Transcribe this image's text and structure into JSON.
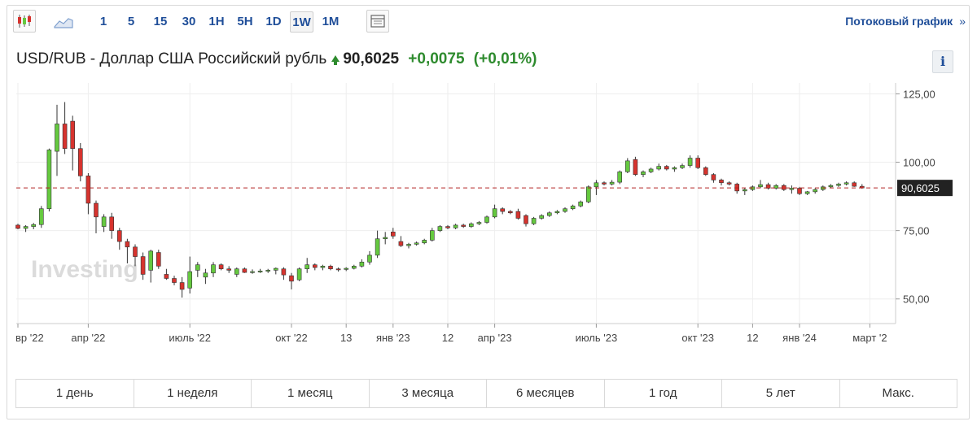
{
  "toolbar": {
    "icons": [
      "candlestick-chart-icon",
      "area-chart-icon",
      "table-view-icon"
    ],
    "intervals": [
      "1",
      "5",
      "15",
      "30",
      "1H",
      "5H",
      "1D",
      "1W",
      "1M"
    ],
    "active_interval": "1W",
    "stream_link": "Потоковый график",
    "stream_chevron": "»"
  },
  "header": {
    "pair": "USD/RUB - Доллар США Российский рубль",
    "price": "90,6025",
    "change": "+0,0075",
    "change_pct": "(+0,01%)",
    "info": "i"
  },
  "watermark": "Investing",
  "price_tag": "90,6025",
  "range_buttons": [
    "1 день",
    "1 неделя",
    "1 месяц",
    "3 месяца",
    "6 месяцев",
    "1 год",
    "5 лет",
    "Макс."
  ],
  "colors": {
    "up": "#65c93f",
    "down": "#d6332e",
    "link": "#1f4e99",
    "change": "#2e8b2e",
    "price_line": "#b22222"
  },
  "chart_data": {
    "type": "candlestick",
    "interval": "1W",
    "y_ticks": [
      "125,00",
      "100,00",
      "75,00",
      "50,00"
    ],
    "y_tick_values": [
      125,
      100,
      75,
      50
    ],
    "ylim": [
      41,
      129
    ],
    "x_ticks": [
      {
        "label": "вр '22",
        "i": 0
      },
      {
        "label": "апр '22",
        "i": 9
      },
      {
        "label": "июль '22",
        "i": 22
      },
      {
        "label": "окт '22",
        "i": 35
      },
      {
        "label": "13",
        "i": 42
      },
      {
        "label": "янв '23",
        "i": 48
      },
      {
        "label": "12",
        "i": 55
      },
      {
        "label": "апр '23",
        "i": 61
      },
      {
        "label": "июль '23",
        "i": 74
      },
      {
        "label": "окт '23",
        "i": 87
      },
      {
        "label": "12",
        "i": 94
      },
      {
        "label": "янв '24",
        "i": 100
      },
      {
        "label": "март '2",
        "i": 109
      }
    ],
    "last_price": 90.6025,
    "candles": [
      [
        77.0,
        77.5,
        75.5,
        75.8
      ],
      [
        75.8,
        77.0,
        74.5,
        76.5
      ],
      [
        76.5,
        77.8,
        75.5,
        77.2
      ],
      [
        77.2,
        84.0,
        76.0,
        83.0
      ],
      [
        83.0,
        105.0,
        82.0,
        104.5
      ],
      [
        104.0,
        121.0,
        95.0,
        114.0
      ],
      [
        114.0,
        122.0,
        103.0,
        105.0
      ],
      [
        115.0,
        117.0,
        97.0,
        105.0
      ],
      [
        105.0,
        107.0,
        93.0,
        95.0
      ],
      [
        95.0,
        96.0,
        81.0,
        85.0
      ],
      [
        85.0,
        86.0,
        74.0,
        80.0
      ],
      [
        76.5,
        81.0,
        74.5,
        80.0
      ],
      [
        80.0,
        81.5,
        72.0,
        75.0
      ],
      [
        75.0,
        76.0,
        68.0,
        71.0
      ],
      [
        71.0,
        72.0,
        63.0,
        69.0
      ],
      [
        69.0,
        70.0,
        62.0,
        65.5
      ],
      [
        65.5,
        67.0,
        57.0,
        59.0
      ],
      [
        60.5,
        68.0,
        56.0,
        67.5
      ],
      [
        67.0,
        68.0,
        61.0,
        62.0
      ],
      [
        59.0,
        61.0,
        57.0,
        57.5
      ],
      [
        57.5,
        58.5,
        55.0,
        56.0
      ],
      [
        56.0,
        58.0,
        50.5,
        53.5
      ],
      [
        54.0,
        65.5,
        52.0,
        60.0
      ],
      [
        60.5,
        63.5,
        58.0,
        62.5
      ],
      [
        58.0,
        61.0,
        55.5,
        59.5
      ],
      [
        59.5,
        63.5,
        58.0,
        62.5
      ],
      [
        62.5,
        63.0,
        60.5,
        61.0
      ],
      [
        61.0,
        62.0,
        59.5,
        60.5
      ],
      [
        59.0,
        61.5,
        58.0,
        61.0
      ],
      [
        61.0,
        61.5,
        59.5,
        59.7
      ],
      [
        59.7,
        60.8,
        59.2,
        60.0
      ],
      [
        60.0,
        61.0,
        59.5,
        60.2
      ],
      [
        60.2,
        61.0,
        59.5,
        60.5
      ],
      [
        60.5,
        61.5,
        59.0,
        61.2
      ],
      [
        61.0,
        61.6,
        57.0,
        58.8
      ],
      [
        58.5,
        59.5,
        53.5,
        56.5
      ],
      [
        57.0,
        61.5,
        56.5,
        61.0
      ],
      [
        61.0,
        65.0,
        59.5,
        62.5
      ],
      [
        62.5,
        63.0,
        60.5,
        61.5
      ],
      [
        61.5,
        62.5,
        60.5,
        62.0
      ],
      [
        62.0,
        62.5,
        60.5,
        61.0
      ],
      [
        61.0,
        61.5,
        60.0,
        60.8
      ],
      [
        60.8,
        61.6,
        60.2,
        61.2
      ],
      [
        61.2,
        62.5,
        60.8,
        62.0
      ],
      [
        62.0,
        64.5,
        61.5,
        63.5
      ],
      [
        63.5,
        67.5,
        62.5,
        66.0
      ],
      [
        66.0,
        75.0,
        65.0,
        72.0
      ],
      [
        72.0,
        74.5,
        70.0,
        72.5
      ],
      [
        74.5,
        76.0,
        72.0,
        73.0
      ],
      [
        71.0,
        73.0,
        69.0,
        69.5
      ],
      [
        69.5,
        70.5,
        68.5,
        70.0
      ],
      [
        70.0,
        71.0,
        69.5,
        70.5
      ],
      [
        70.5,
        72.0,
        70.0,
        71.5
      ],
      [
        71.5,
        76.0,
        71.0,
        75.0
      ],
      [
        75.0,
        77.0,
        74.5,
        76.5
      ],
      [
        76.5,
        77.0,
        75.5,
        76.0
      ],
      [
        76.0,
        77.5,
        75.5,
        77.0
      ],
      [
        77.0,
        77.5,
        76.0,
        76.5
      ],
      [
        76.5,
        78.0,
        76.0,
        77.5
      ],
      [
        77.5,
        78.5,
        77.0,
        78.0
      ],
      [
        78.0,
        80.5,
        77.5,
        80.0
      ],
      [
        80.0,
        84.5,
        79.5,
        83.0
      ],
      [
        83.0,
        83.5,
        81.0,
        82.0
      ],
      [
        82.0,
        82.5,
        81.0,
        81.5
      ],
      [
        82.0,
        83.0,
        79.0,
        79.5
      ],
      [
        80.5,
        81.0,
        76.5,
        77.5
      ],
      [
        77.5,
        80.0,
        77.0,
        79.5
      ],
      [
        79.5,
        81.0,
        79.0,
        80.5
      ],
      [
        80.5,
        82.0,
        80.0,
        81.5
      ],
      [
        81.5,
        82.5,
        81.0,
        82.0
      ],
      [
        82.0,
        83.5,
        81.5,
        83.0
      ],
      [
        83.0,
        84.5,
        82.5,
        84.0
      ],
      [
        84.0,
        86.0,
        83.5,
        85.5
      ],
      [
        85.5,
        91.5,
        85.0,
        91.0
      ],
      [
        91.0,
        93.5,
        88.0,
        92.5
      ],
      [
        92.5,
        93.0,
        91.5,
        92.0
      ],
      [
        92.0,
        93.5,
        91.5,
        92.7
      ],
      [
        92.7,
        97.0,
        92.0,
        96.5
      ],
      [
        96.5,
        101.5,
        96.0,
        100.5
      ],
      [
        101.0,
        102.0,
        95.0,
        95.5
      ],
      [
        95.5,
        97.0,
        94.5,
        96.5
      ],
      [
        96.5,
        98.0,
        96.0,
        97.5
      ],
      [
        97.5,
        99.5,
        97.0,
        98.5
      ],
      [
        98.5,
        99.0,
        97.0,
        97.5
      ],
      [
        97.5,
        98.5,
        96.5,
        98.0
      ],
      [
        98.0,
        99.5,
        97.5,
        98.8
      ],
      [
        98.8,
        102.5,
        98.0,
        101.5
      ],
      [
        101.5,
        102.5,
        97.5,
        98.0
      ],
      [
        98.0,
        98.5,
        95.0,
        95.5
      ],
      [
        95.5,
        96.0,
        92.5,
        93.5
      ],
      [
        93.5,
        94.0,
        91.5,
        92.5
      ],
      [
        92.5,
        93.0,
        91.5,
        92.0
      ],
      [
        92.0,
        92.5,
        88.5,
        89.5
      ],
      [
        89.5,
        90.5,
        88.0,
        90.0
      ],
      [
        90.0,
        91.5,
        89.5,
        91.0
      ],
      [
        91.0,
        93.5,
        90.5,
        91.8
      ],
      [
        91.8,
        92.5,
        90.0,
        90.5
      ],
      [
        90.5,
        92.0,
        90.0,
        91.5
      ],
      [
        91.5,
        92.0,
        89.5,
        90.0
      ],
      [
        90.0,
        91.5,
        88.5,
        90.5
      ],
      [
        90.5,
        91.0,
        88.0,
        88.5
      ],
      [
        88.5,
        89.5,
        88.0,
        89.2
      ],
      [
        89.2,
        90.5,
        88.5,
        90.0
      ],
      [
        90.0,
        91.5,
        89.5,
        91.0
      ],
      [
        91.0,
        92.0,
        90.5,
        91.5
      ],
      [
        91.5,
        92.5,
        91.0,
        92.0
      ],
      [
        92.0,
        93.0,
        91.5,
        92.5
      ],
      [
        92.5,
        93.0,
        91.0,
        91.2
      ],
      [
        91.2,
        92.0,
        90.3,
        90.6
      ]
    ]
  }
}
